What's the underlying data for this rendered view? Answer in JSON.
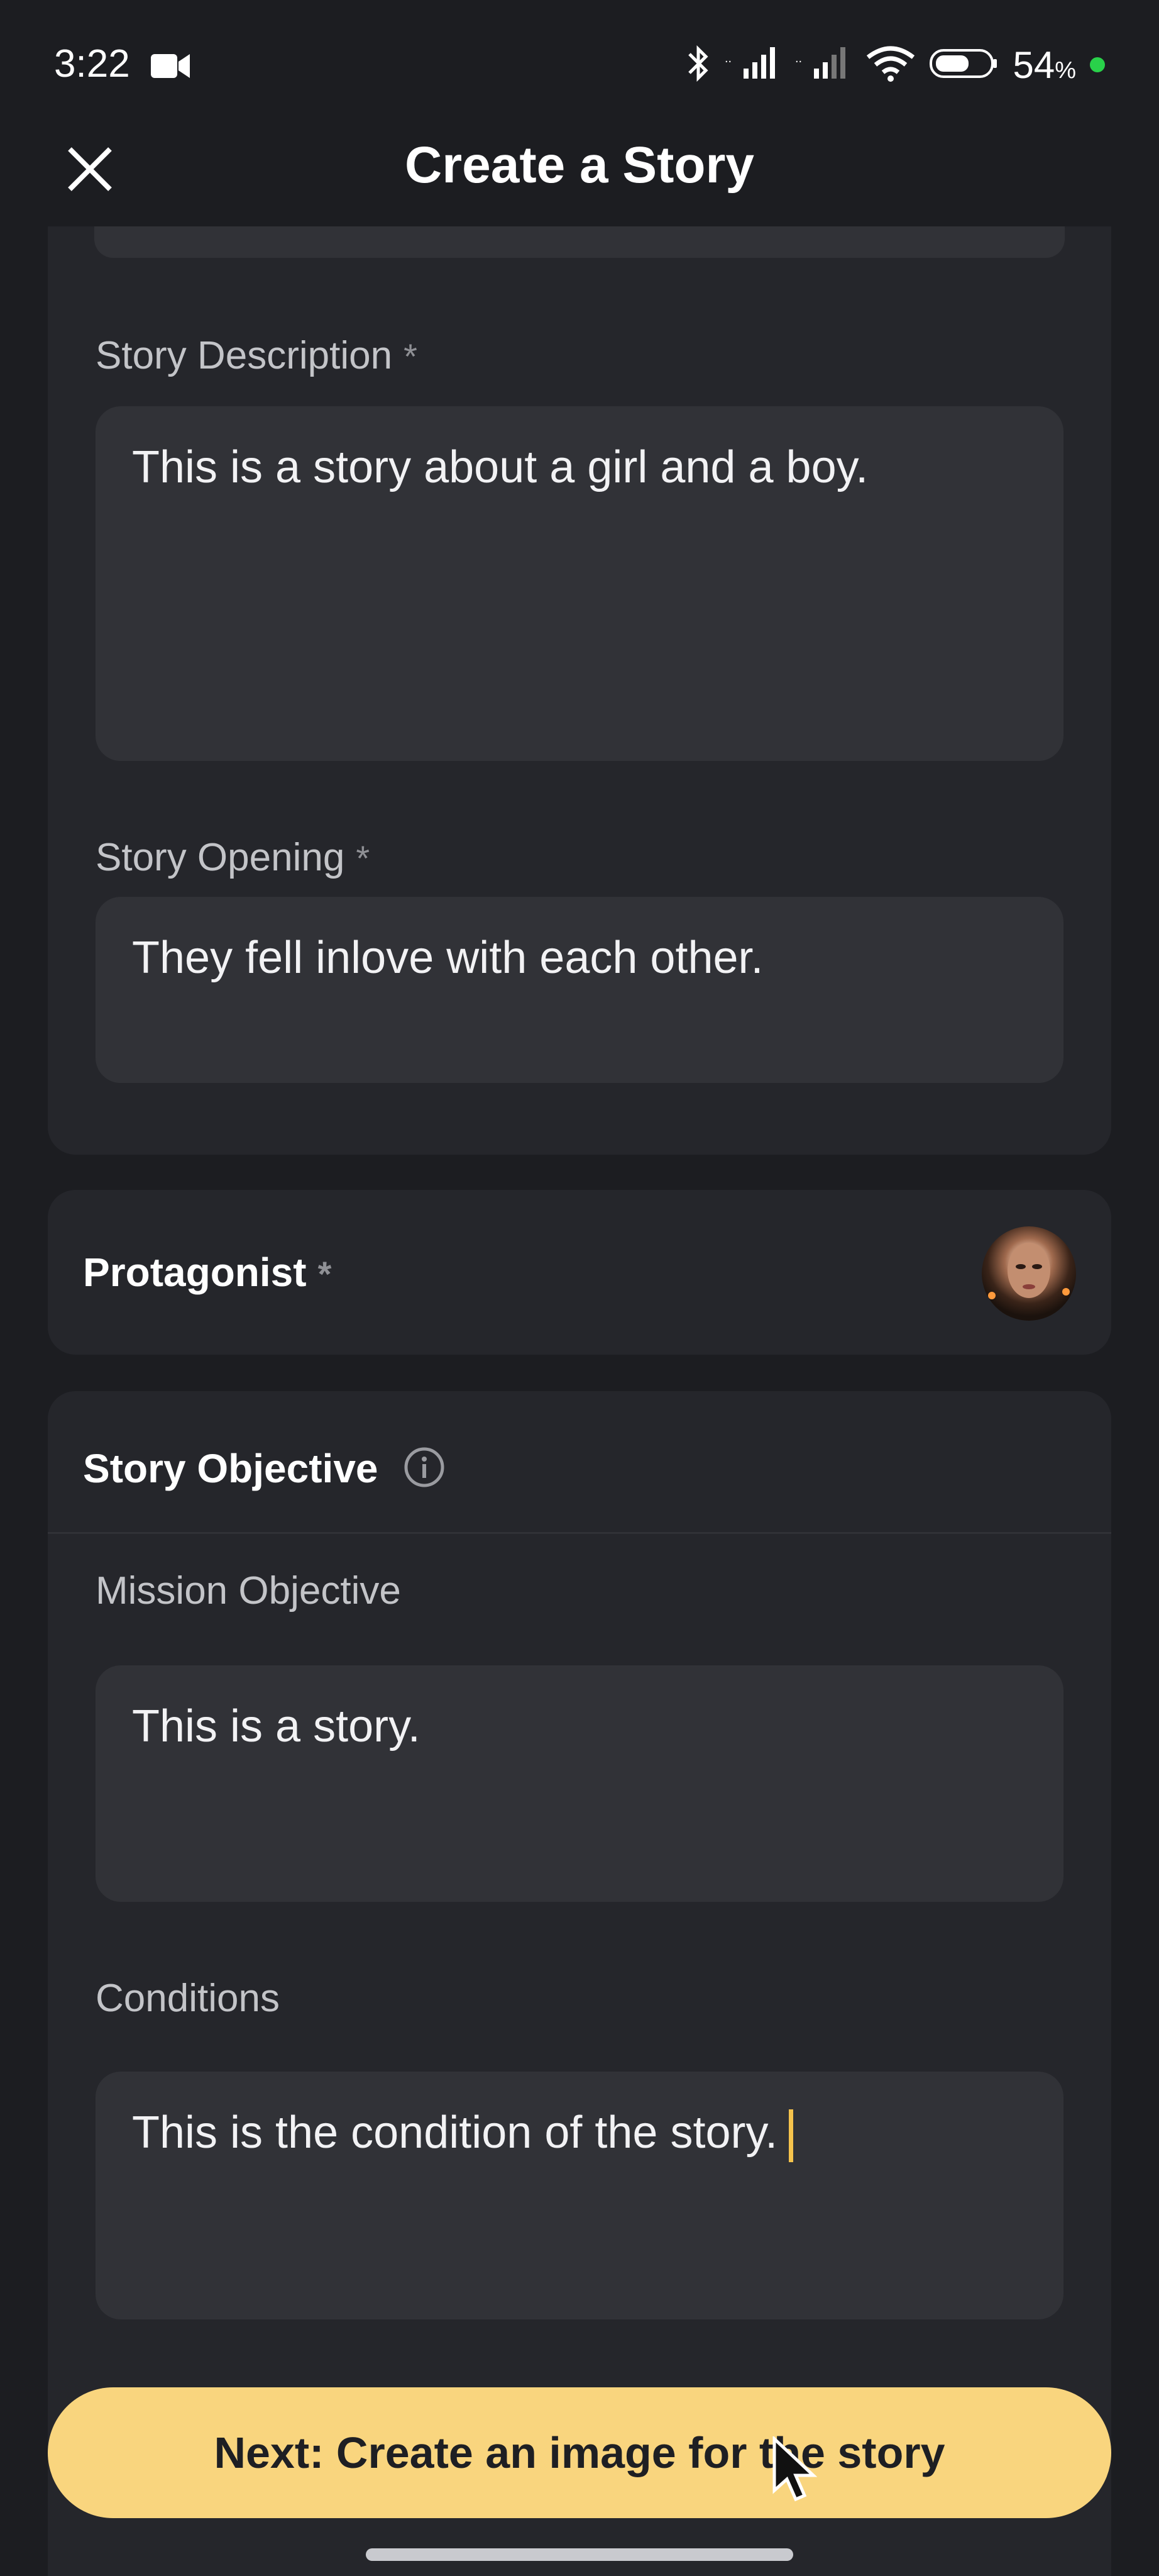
{
  "status_bar": {
    "time": "3:22",
    "battery_percent": "54",
    "battery_unit": "%"
  },
  "header": {
    "title": "Create a Story"
  },
  "story_description": {
    "label": "Story Description",
    "required_mark": "*",
    "value": "This is a story about a girl and a boy."
  },
  "story_opening": {
    "label": "Story Opening",
    "required_mark": "*",
    "value": "They fell inlove with each other."
  },
  "protagonist": {
    "label": "Protagonist",
    "required_mark": "*"
  },
  "story_objective": {
    "title": "Story Objective",
    "mission_label": "Mission Objective",
    "mission_value": "This is a story.",
    "conditions_label": "Conditions",
    "conditions_value": "This is the condition of the story."
  },
  "next_button": {
    "label": "Next: Create an image for the story"
  },
  "colors": {
    "background": "#1c1d21",
    "card": "#25262b",
    "input": "#313237",
    "accent": "#f9d57e",
    "caret": "#f5c34c"
  }
}
